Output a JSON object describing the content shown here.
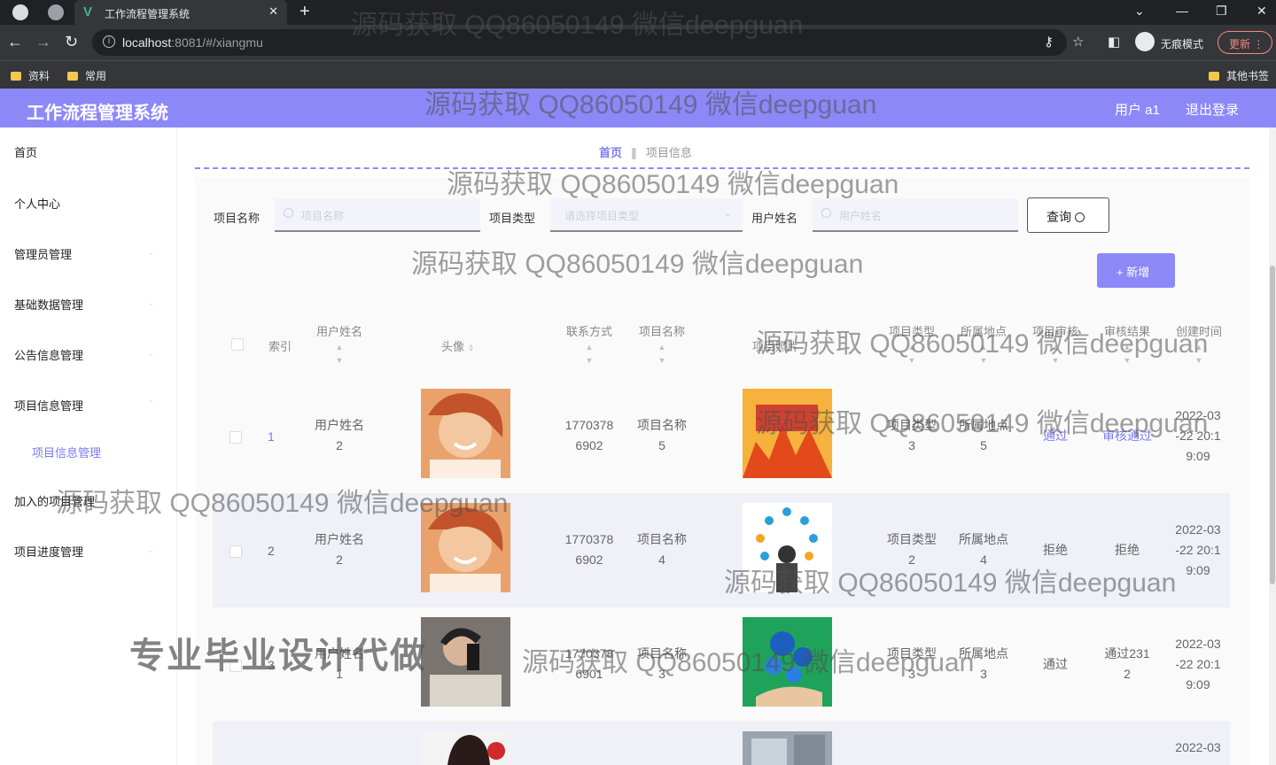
{
  "browser": {
    "tab_title": "工作流程管理系统",
    "url_host": "localhost",
    "url_rest": ":8081/#/xiangmu",
    "incognito_label": "无痕模式",
    "update_label": "更新",
    "bookmarks": [
      "资料",
      "常用"
    ],
    "other_bookmarks": "其他书签"
  },
  "header": {
    "title": "工作流程管理系统",
    "user": "用户 a1",
    "logout": "退出登录"
  },
  "sidebar": {
    "items": [
      "首页",
      "个人中心",
      "管理员管理",
      "基础数据管理",
      "公告信息管理",
      "项目信息管理"
    ],
    "sub_item": "项目信息管理",
    "items_after": [
      "加入的项目管理",
      "项目进度管理"
    ]
  },
  "breadcrumb": {
    "home": "首页",
    "current": "项目信息"
  },
  "search": {
    "name_label": "项目名称",
    "name_placeholder": "项目名称",
    "type_label": "项目类型",
    "type_placeholder": "请选择项目类型",
    "user_label": "用户姓名",
    "user_placeholder": "用户姓名",
    "query_label": "查询",
    "add_label": "+ 新增"
  },
  "table": {
    "headers": {
      "index": "索引",
      "user_name": "用户姓名",
      "avatar": "头像",
      "phone": "联系方式",
      "project_name": "项目名称",
      "project_photo": "项目照片",
      "project_type": "项目类型",
      "location": "所属地点",
      "review": "项目审核",
      "result": "审核结果",
      "created": "创建时间"
    },
    "rows": [
      {
        "index": "1",
        "user": [
          "用户姓名",
          "2"
        ],
        "phone": [
          "1770378",
          "6902"
        ],
        "project": [
          "项目名称",
          "5"
        ],
        "type": [
          "项目类型",
          "3"
        ],
        "location": [
          "所属地点",
          "5"
        ],
        "review": "通过",
        "result": "审核通过",
        "created": [
          "2022-03",
          "-22 20:1",
          "9:09"
        ]
      },
      {
        "index": "2",
        "user": [
          "用户姓名",
          "2"
        ],
        "phone": [
          "1770378",
          "6902"
        ],
        "project": [
          "项目名称",
          "4"
        ],
        "type": [
          "项目类型",
          "2"
        ],
        "location": [
          "所属地点",
          "4"
        ],
        "review": "拒绝",
        "result": "拒绝",
        "created": [
          "2022-03",
          "-22 20:1",
          "9:09"
        ]
      },
      {
        "index": "3",
        "user": [
          "用户姓名",
          "1"
        ],
        "phone": [
          "1770378",
          "6901"
        ],
        "project": [
          "项目名称",
          "3"
        ],
        "type": [
          "项目类型",
          "3"
        ],
        "location": [
          "所属地点",
          "3"
        ],
        "review": "通过",
        "result": "通过231",
        "result2": "2",
        "created": [
          "2022-03",
          "-22 20:1",
          "9:09"
        ]
      },
      {
        "created": [
          "2022-03"
        ]
      }
    ]
  },
  "watermarks": {
    "text": "源码获取 QQ86050149 微信deepguan",
    "big": "专业毕业设计代做"
  },
  "colors": {
    "accent": "#8c88f8",
    "link": "#7d79f2",
    "chrome_dark": "#202124"
  }
}
